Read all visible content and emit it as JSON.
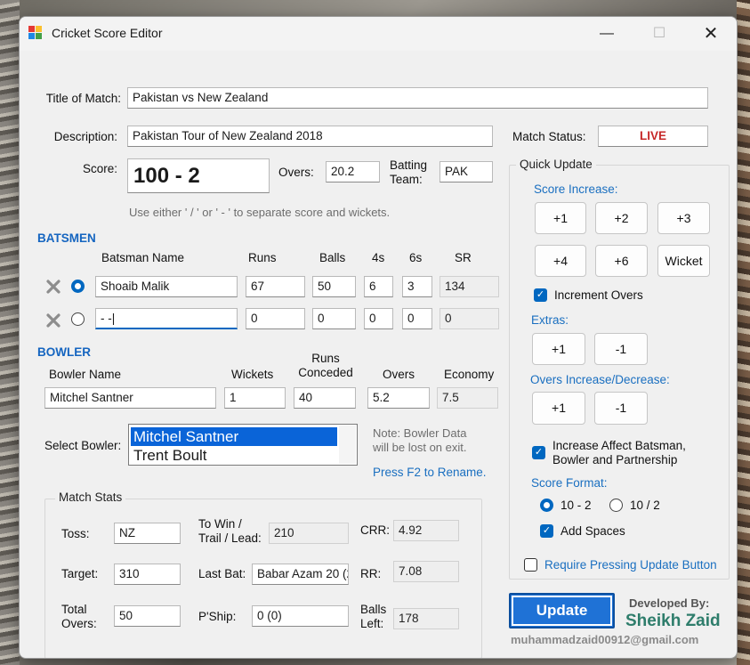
{
  "window": {
    "title": "Cricket Score Editor"
  },
  "match": {
    "title_label": "Title of Match:",
    "title_value": "Pakistan vs New Zealand",
    "desc_label": "Description:",
    "desc_value": "Pakistan Tour of New Zealand 2018",
    "status_label": "Match Status:",
    "status_value": "LIVE",
    "score_label": "Score:",
    "score_value": "100 - 2",
    "overs_label": "Overs:",
    "overs_value": "20.2",
    "batting_team_label": "Batting\nTeam:",
    "batting_team_value": "PAK",
    "score_hint": "Use either  ' / '  or  ' - '  to separate score and wickets."
  },
  "batsmen": {
    "heading": "BATSMEN",
    "columns": [
      "Batsman Name",
      "Runs",
      "Balls",
      "4s",
      "6s",
      "SR"
    ],
    "rows": [
      {
        "name": "Shoaib Malik",
        "runs": "67",
        "balls": "50",
        "fours": "6",
        "sixes": "3",
        "sr": "134",
        "on_strike": true
      },
      {
        "name": "- -|",
        "runs": "0",
        "balls": "0",
        "fours": "0",
        "sixes": "0",
        "sr": "0",
        "on_strike": false
      }
    ]
  },
  "bowler": {
    "heading": "BOWLER",
    "columns": [
      "Bowler Name",
      "Wickets",
      "Runs\nConceded",
      "Overs",
      "Economy"
    ],
    "name": "Mitchel Santner",
    "wickets": "1",
    "runs_conceded": "40",
    "overs": "5.2",
    "economy": "7.5",
    "select_label": "Select Bowler:",
    "list": [
      "Mitchel Santner",
      "Trent Boult"
    ],
    "note": "Note: Bowler Data\nwill be lost on exit.",
    "rename_hint": "Press F2 to Rename."
  },
  "match_stats": {
    "title": "Match Stats",
    "toss_label": "Toss:",
    "toss_value": "NZ",
    "to_win_label": "To Win /\nTrail / Lead:",
    "to_win_value": "210",
    "crr_label": "CRR:",
    "crr_value": "4.92",
    "target_label": "Target:",
    "target_value": "310",
    "last_bat_label": "Last Bat:",
    "last_bat_value": "Babar Azam 20 (2",
    "rr_label": "RR:",
    "rr_value": "7.08",
    "total_overs_label": "Total\nOvers:",
    "total_overs_value": "50",
    "pship_label": "P'Ship:",
    "pship_value": "0 (0)",
    "balls_left_label": "Balls\nLeft:",
    "balls_left_value": "178"
  },
  "quick_update": {
    "title": "Quick Update",
    "score_increase_label": "Score Increase:",
    "score_buttons": [
      "+1",
      "+2",
      "+3",
      "+4",
      "+6",
      "Wicket"
    ],
    "increment_overs_label": "Increment Overs",
    "extras_label": "Extras:",
    "extras_buttons": [
      "+1",
      "-1"
    ],
    "overs_label": "Overs Increase/Decrease:",
    "overs_buttons": [
      "+1",
      "-1"
    ],
    "affect_label": "Increase Affect Batsman,\nBowler and Partnership",
    "score_format_label": "Score Format:",
    "format_options": [
      "10 - 2",
      "10 / 2"
    ],
    "add_spaces_label": "Add Spaces"
  },
  "footer": {
    "require_update_label": "Require Pressing Update Button",
    "update_button": "Update",
    "developed_by": "Developed By:",
    "developer": "Sheikh Zaid",
    "email": "muhammadzaid00912@gmail.com"
  },
  "colors": {
    "accent": "#0067c0",
    "heading": "#1565c0",
    "live": "#c62828",
    "developer": "#2e7d6b"
  }
}
